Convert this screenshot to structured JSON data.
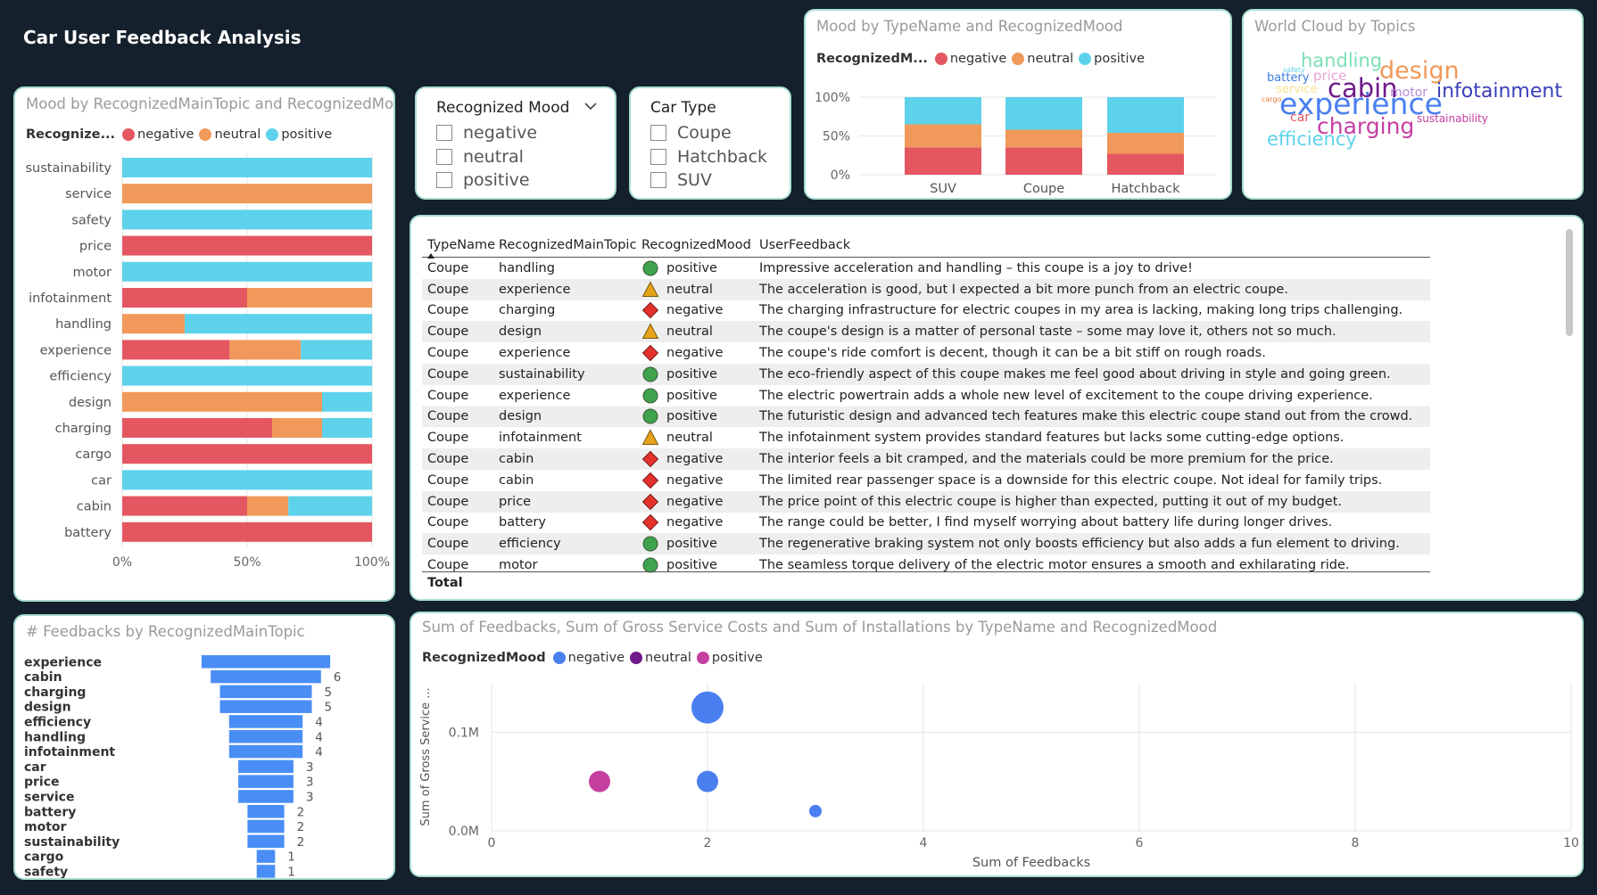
{
  "page_title": "Car User Feedback Analysis",
  "colors": {
    "negative": "#e45761",
    "neutral": "#f0995a",
    "positive": "#5ed2ea",
    "bar": "#4a8ef5",
    "bubble_negative": "#4a7ff0",
    "bubble_neutral": "#6e1a8a",
    "bubble_positive": "#c53fa0"
  },
  "mood_topic": {
    "title": "Mood by RecognizedMainTopic and RecognizedMood",
    "legend_title": "Recognize...",
    "legend": [
      "negative",
      "neutral",
      "positive"
    ],
    "x_ticks": [
      "0%",
      "50%",
      "100%"
    ]
  },
  "slicer_mood": {
    "title": "Recognized Mood",
    "options": [
      "negative",
      "neutral",
      "positive"
    ]
  },
  "slicer_car": {
    "title": "Car Type",
    "options": [
      "Coupe",
      "Hatchback",
      "SUV"
    ]
  },
  "mood_type": {
    "title": "Mood by TypeName and RecognizedMood",
    "legend_title": "RecognizedM...",
    "legend": [
      "negative",
      "neutral",
      "positive"
    ],
    "y_ticks": [
      "100%",
      "50%",
      "0%"
    ]
  },
  "word_cloud": {
    "title": "World Cloud by Topics",
    "words": [
      {
        "text": "handling",
        "color": "#7ce0b5",
        "size": 21
      },
      {
        "text": "design",
        "color": "#f0995a",
        "size": 27
      },
      {
        "text": "battery",
        "color": "#3d7ae0",
        "size": 13
      },
      {
        "text": "price",
        "color": "#e7a5d4",
        "size": 15
      },
      {
        "text": "safety",
        "color": "#5ed2ea",
        "size": 8
      },
      {
        "text": "service",
        "color": "#f7e08c",
        "size": 13
      },
      {
        "text": "cabin",
        "color": "#6e1a8a",
        "size": 29
      },
      {
        "text": "motor",
        "color": "#b889d6",
        "size": 14
      },
      {
        "text": "infotainment",
        "color": "#3b3fb7",
        "size": 22
      },
      {
        "text": "cargo",
        "color": "#e87a3a",
        "size": 8
      },
      {
        "text": "experience",
        "color": "#4a7ff0",
        "size": 33
      },
      {
        "text": "car",
        "color": "#e45761",
        "size": 14
      },
      {
        "text": "charging",
        "color": "#c53fa0",
        "size": 25
      },
      {
        "text": "sustainability",
        "color": "#c53fa0",
        "size": 12
      },
      {
        "text": "efficiency",
        "color": "#5ed2ea",
        "size": 21
      }
    ]
  },
  "table": {
    "headers": [
      "TypeName",
      "RecognizedMainTopic",
      "RecognizedMood",
      "UserFeedback"
    ],
    "rows": [
      [
        "Coupe",
        "handling",
        "positive",
        "Impressive acceleration and handling – this coupe is a joy to drive!"
      ],
      [
        "Coupe",
        "experience",
        "neutral",
        "The acceleration is good, but I expected a bit more punch from an electric coupe."
      ],
      [
        "Coupe",
        "charging",
        "negative",
        "The charging infrastructure for electric coupes in my area is lacking, making long trips challenging."
      ],
      [
        "Coupe",
        "design",
        "neutral",
        "The coupe's design is a matter of personal taste – some may love it, others not so much."
      ],
      [
        "Coupe",
        "experience",
        "negative",
        "The coupe's ride comfort is decent, though it can be a bit stiff on rough roads."
      ],
      [
        "Coupe",
        "sustainability",
        "positive",
        "The eco-friendly aspect of this coupe makes me feel good about driving in style and going green."
      ],
      [
        "Coupe",
        "experience",
        "positive",
        "The electric powertrain adds a whole new level of excitement to the coupe driving experience."
      ],
      [
        "Coupe",
        "design",
        "positive",
        "The futuristic design and advanced tech features make this electric coupe stand out from the crowd."
      ],
      [
        "Coupe",
        "infotainment",
        "neutral",
        "The infotainment system provides standard features but lacks some cutting-edge options."
      ],
      [
        "Coupe",
        "cabin",
        "negative",
        "The interior feels a bit cramped, and the materials could be more premium for the price."
      ],
      [
        "Coupe",
        "cabin",
        "negative",
        "The limited rear passenger space is a downside for this electric coupe. Not ideal for family trips."
      ],
      [
        "Coupe",
        "price",
        "negative",
        "The price point of this electric coupe is higher than expected, putting it out of my budget."
      ],
      [
        "Coupe",
        "battery",
        "negative",
        "The range could be better, I find myself worrying about battery life during longer drives."
      ],
      [
        "Coupe",
        "efficiency",
        "positive",
        "The regenerative braking system not only boosts efficiency but also adds a fun element to driving."
      ],
      [
        "Coupe",
        "motor",
        "positive",
        "The seamless torque delivery of the electric motor ensures a smooth and exhilarating ride."
      ]
    ],
    "total_label": "Total"
  },
  "feedback_count": {
    "title": "# Feedbacks by RecognizedMainTopic"
  },
  "bubble": {
    "title": "Sum of Feedbacks, Sum of Gross Service Costs and Sum of Installations by TypeName and RecognizedMood",
    "legend_title": "RecognizedMood",
    "legend": [
      "negative",
      "neutral",
      "positive"
    ]
  },
  "chart_data": [
    {
      "type": "bar",
      "stacked": "100%",
      "orientation": "horizontal",
      "title": "Mood by RecognizedMainTopic and RecognizedMood",
      "categories": [
        "sustainability",
        "service",
        "safety",
        "price",
        "motor",
        "infotainment",
        "handling",
        "experience",
        "efficiency",
        "design",
        "charging",
        "cargo",
        "car",
        "cabin",
        "battery"
      ],
      "series": [
        {
          "name": "negative",
          "values": [
            0,
            0,
            0,
            100,
            0,
            50,
            0,
            43,
            0,
            0,
            60,
            100,
            0,
            50,
            100
          ]
        },
        {
          "name": "neutral",
          "values": [
            0,
            100,
            0,
            0,
            0,
            50,
            25,
            28.5,
            0,
            80,
            20,
            0,
            0,
            16.5,
            0
          ]
        },
        {
          "name": "positive",
          "values": [
            100,
            0,
            100,
            0,
            100,
            0,
            75,
            28.5,
            100,
            20,
            20,
            0,
            100,
            33.5,
            0
          ]
        }
      ],
      "xlim": [
        0,
        100
      ],
      "x_ticks": [
        "0%",
        "50%",
        "100%"
      ],
      "legend": "top-left",
      "grid": true
    },
    {
      "type": "bar",
      "stacked": "100%",
      "orientation": "vertical",
      "title": "Mood by TypeName and RecognizedMood",
      "categories": [
        "SUV",
        "Coupe",
        "Hatchback"
      ],
      "series": [
        {
          "name": "negative",
          "values": [
            35,
            35,
            27
          ]
        },
        {
          "name": "neutral",
          "values": [
            30,
            23,
            27
          ]
        },
        {
          "name": "positive",
          "values": [
            35,
            42,
            46
          ]
        }
      ],
      "ylim": [
        0,
        100
      ],
      "y_ticks": [
        "0%",
        "50%",
        "100%"
      ],
      "legend": "top-left",
      "grid": true
    },
    {
      "type": "bar",
      "orientation": "horizontal",
      "title": "# Feedbacks by RecognizedMainTopic",
      "categories": [
        "experience",
        "cabin",
        "charging",
        "design",
        "efficiency",
        "handling",
        "infotainment",
        "car",
        "price",
        "service",
        "battery",
        "motor",
        "sustainability",
        "cargo",
        "safety"
      ],
      "values": [
        7,
        6,
        5,
        5,
        4,
        4,
        4,
        3,
        3,
        3,
        2,
        2,
        2,
        1,
        1
      ],
      "data_labels": [
        "",
        "6",
        "5",
        "5",
        "4",
        "4",
        "4",
        "3",
        "3",
        "3",
        "2",
        "2",
        "2",
        "1",
        "1"
      ],
      "grid": false
    },
    {
      "type": "scatter",
      "title": "Sum of Feedbacks, Sum of Gross Service Costs and Sum of Installations by TypeName and RecognizedMood",
      "xlabel": "Sum of Feedbacks",
      "ylabel": "Sum of Gross Service ...",
      "xlim": [
        0,
        10
      ],
      "ylim": [
        0,
        0.15
      ],
      "x_ticks": [
        "0",
        "2",
        "4",
        "6",
        "8",
        "10"
      ],
      "y_ticks": [
        "0.0M",
        "0.1M"
      ],
      "series": [
        {
          "name": "negative",
          "points": [
            {
              "x": 2,
              "y": 0.125,
              "size": 3
            },
            {
              "x": 2,
              "y": 0.05,
              "size": 2
            },
            {
              "x": 3,
              "y": 0.02,
              "size": 1
            }
          ]
        },
        {
          "name": "positive",
          "points": [
            {
              "x": 1,
              "y": 0.05,
              "size": 2
            }
          ]
        }
      ],
      "legend": "top-left",
      "grid": true
    }
  ]
}
